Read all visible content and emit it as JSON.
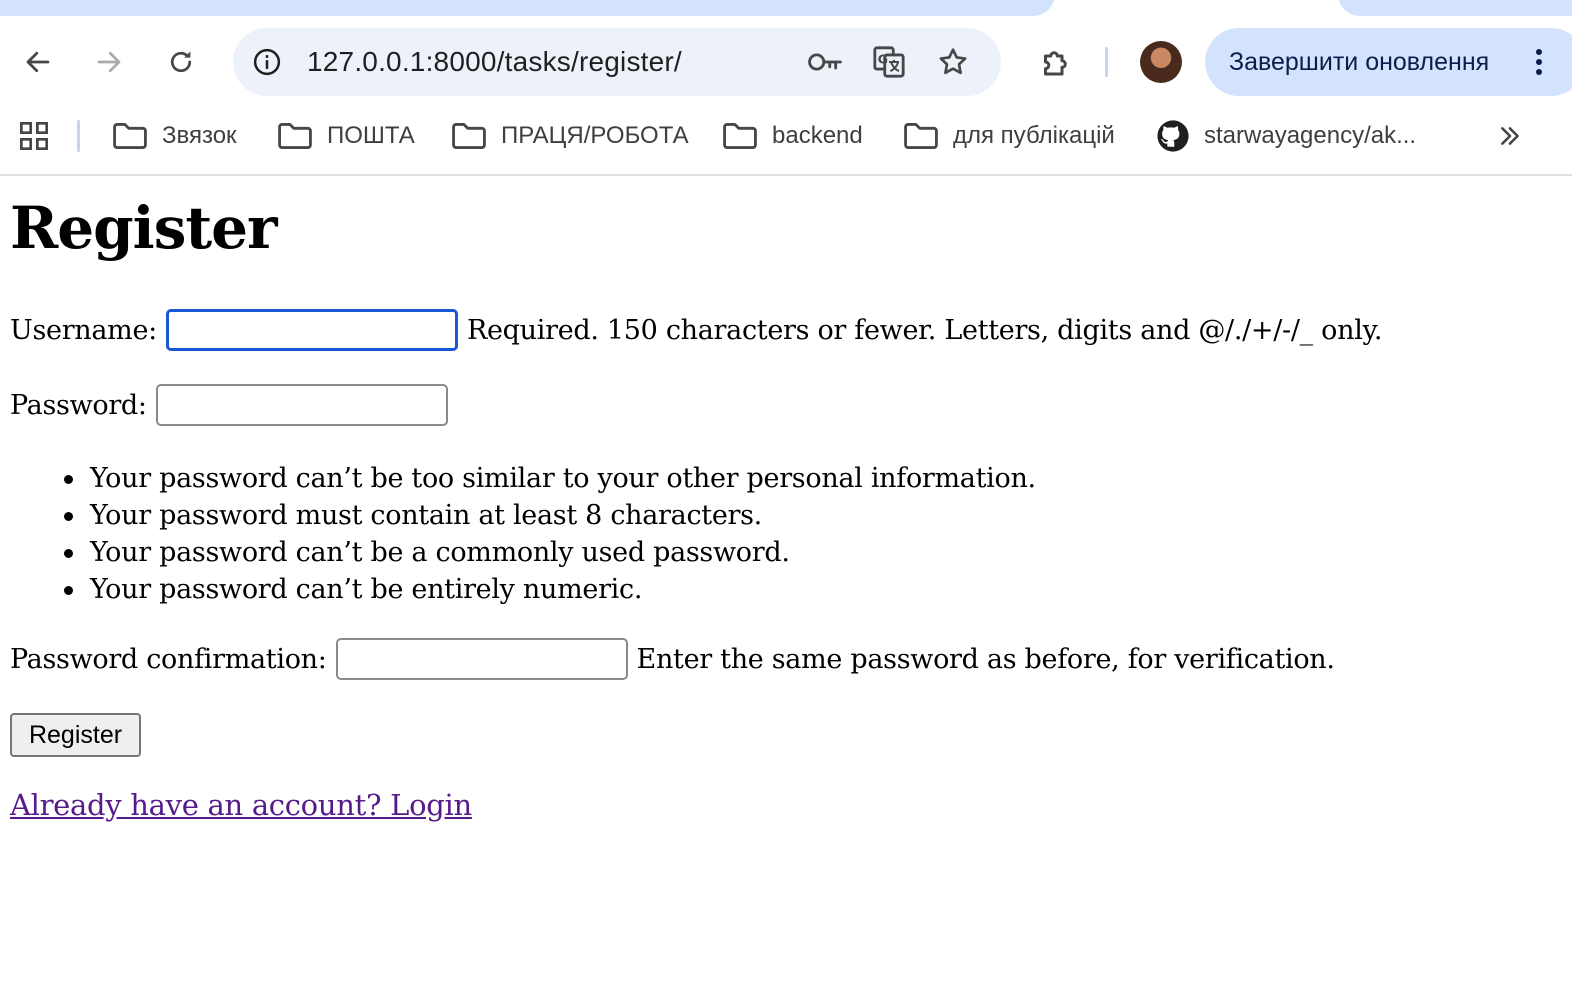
{
  "browser": {
    "url": "127.0.0.1:8000/tasks/register/",
    "update_button_label": "Завершити оновлення",
    "bookmarks": [
      {
        "label": "Звязок",
        "icon": "folder-icon"
      },
      {
        "label": "ПОШТА",
        "icon": "folder-icon"
      },
      {
        "label": "ПРАЦЯ/РОБОТА",
        "icon": "folder-icon"
      },
      {
        "label": "backend",
        "icon": "folder-icon"
      },
      {
        "label": "для публікацій",
        "icon": "folder-icon"
      },
      {
        "label": "starwayagency/ak...",
        "icon": "github-icon"
      }
    ]
  },
  "page": {
    "title": "Register",
    "username": {
      "label": "Username:",
      "value": "",
      "help": "Required. 150 characters or fewer. Letters, digits and @/./+/-/_ only."
    },
    "password": {
      "label": "Password:",
      "value": "",
      "help_items": [
        "Your password can’t be too similar to your other personal information.",
        "Your password must contain at least 8 characters.",
        "Your password can’t be a commonly used password.",
        "Your password can’t be entirely numeric."
      ]
    },
    "password_confirmation": {
      "label": "Password confirmation:",
      "value": "",
      "help": "Enter the same password as before, for verification."
    },
    "submit_label": "Register",
    "login_link": "Already have an account? Login"
  }
}
